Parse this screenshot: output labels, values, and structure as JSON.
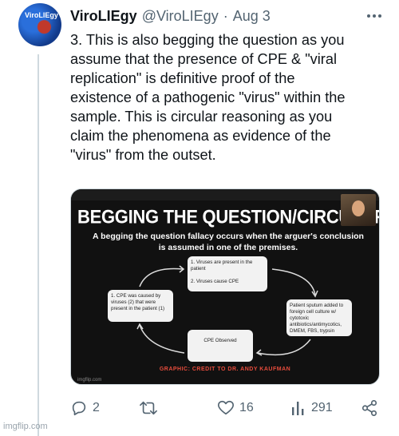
{
  "tweet": {
    "display_name": "ViroLIEgy",
    "handle": "@ViroLIEgy",
    "separator": "·",
    "date": "Aug 3",
    "avatar_text": "ViroLIEgy",
    "text": "3. This is also begging the question as you\nassume that the presence of CPE & \"viral\nreplication\" is definitive proof of the\nexistence of a pathogenic \"virus\" within the\nsample. This is circular reasoning as you\nclaim the phenomena as evidence of the\n\"virus\" from the outset."
  },
  "media": {
    "title": "BEGGING THE QUESTION/CIRCULAR REASO...",
    "subtitle": "A begging the question fallacy occurs when the arguer's conclusion is assumed in one of the premises.",
    "box_top": "1. Viruses are present in the patient\n\n2. Viruses cause CPE",
    "box_left": "1. CPE was caused by viruses (2) that were present in the patient (1)",
    "box_right": "Patient sputum added to foreign cell culture w/ cytotoxic antibiotics/antimycotics, DMEM, FBS, trypsin",
    "box_bottom": "CPE Observed",
    "credit": "GRAPHIC: CREDIT TO DR. ANDY KAUFMAN",
    "watermark": "imgflip.com"
  },
  "actions": {
    "reply_count": "2",
    "retweet_count": "",
    "like_count": "16",
    "views_count": "291"
  },
  "footer": {
    "watermark": "imgflip.com"
  },
  "icons": {
    "reply": "reply-icon",
    "retweet": "retweet-icon",
    "like": "heart-icon",
    "views": "views-icon",
    "share": "share-icon",
    "more": "more-icon"
  }
}
